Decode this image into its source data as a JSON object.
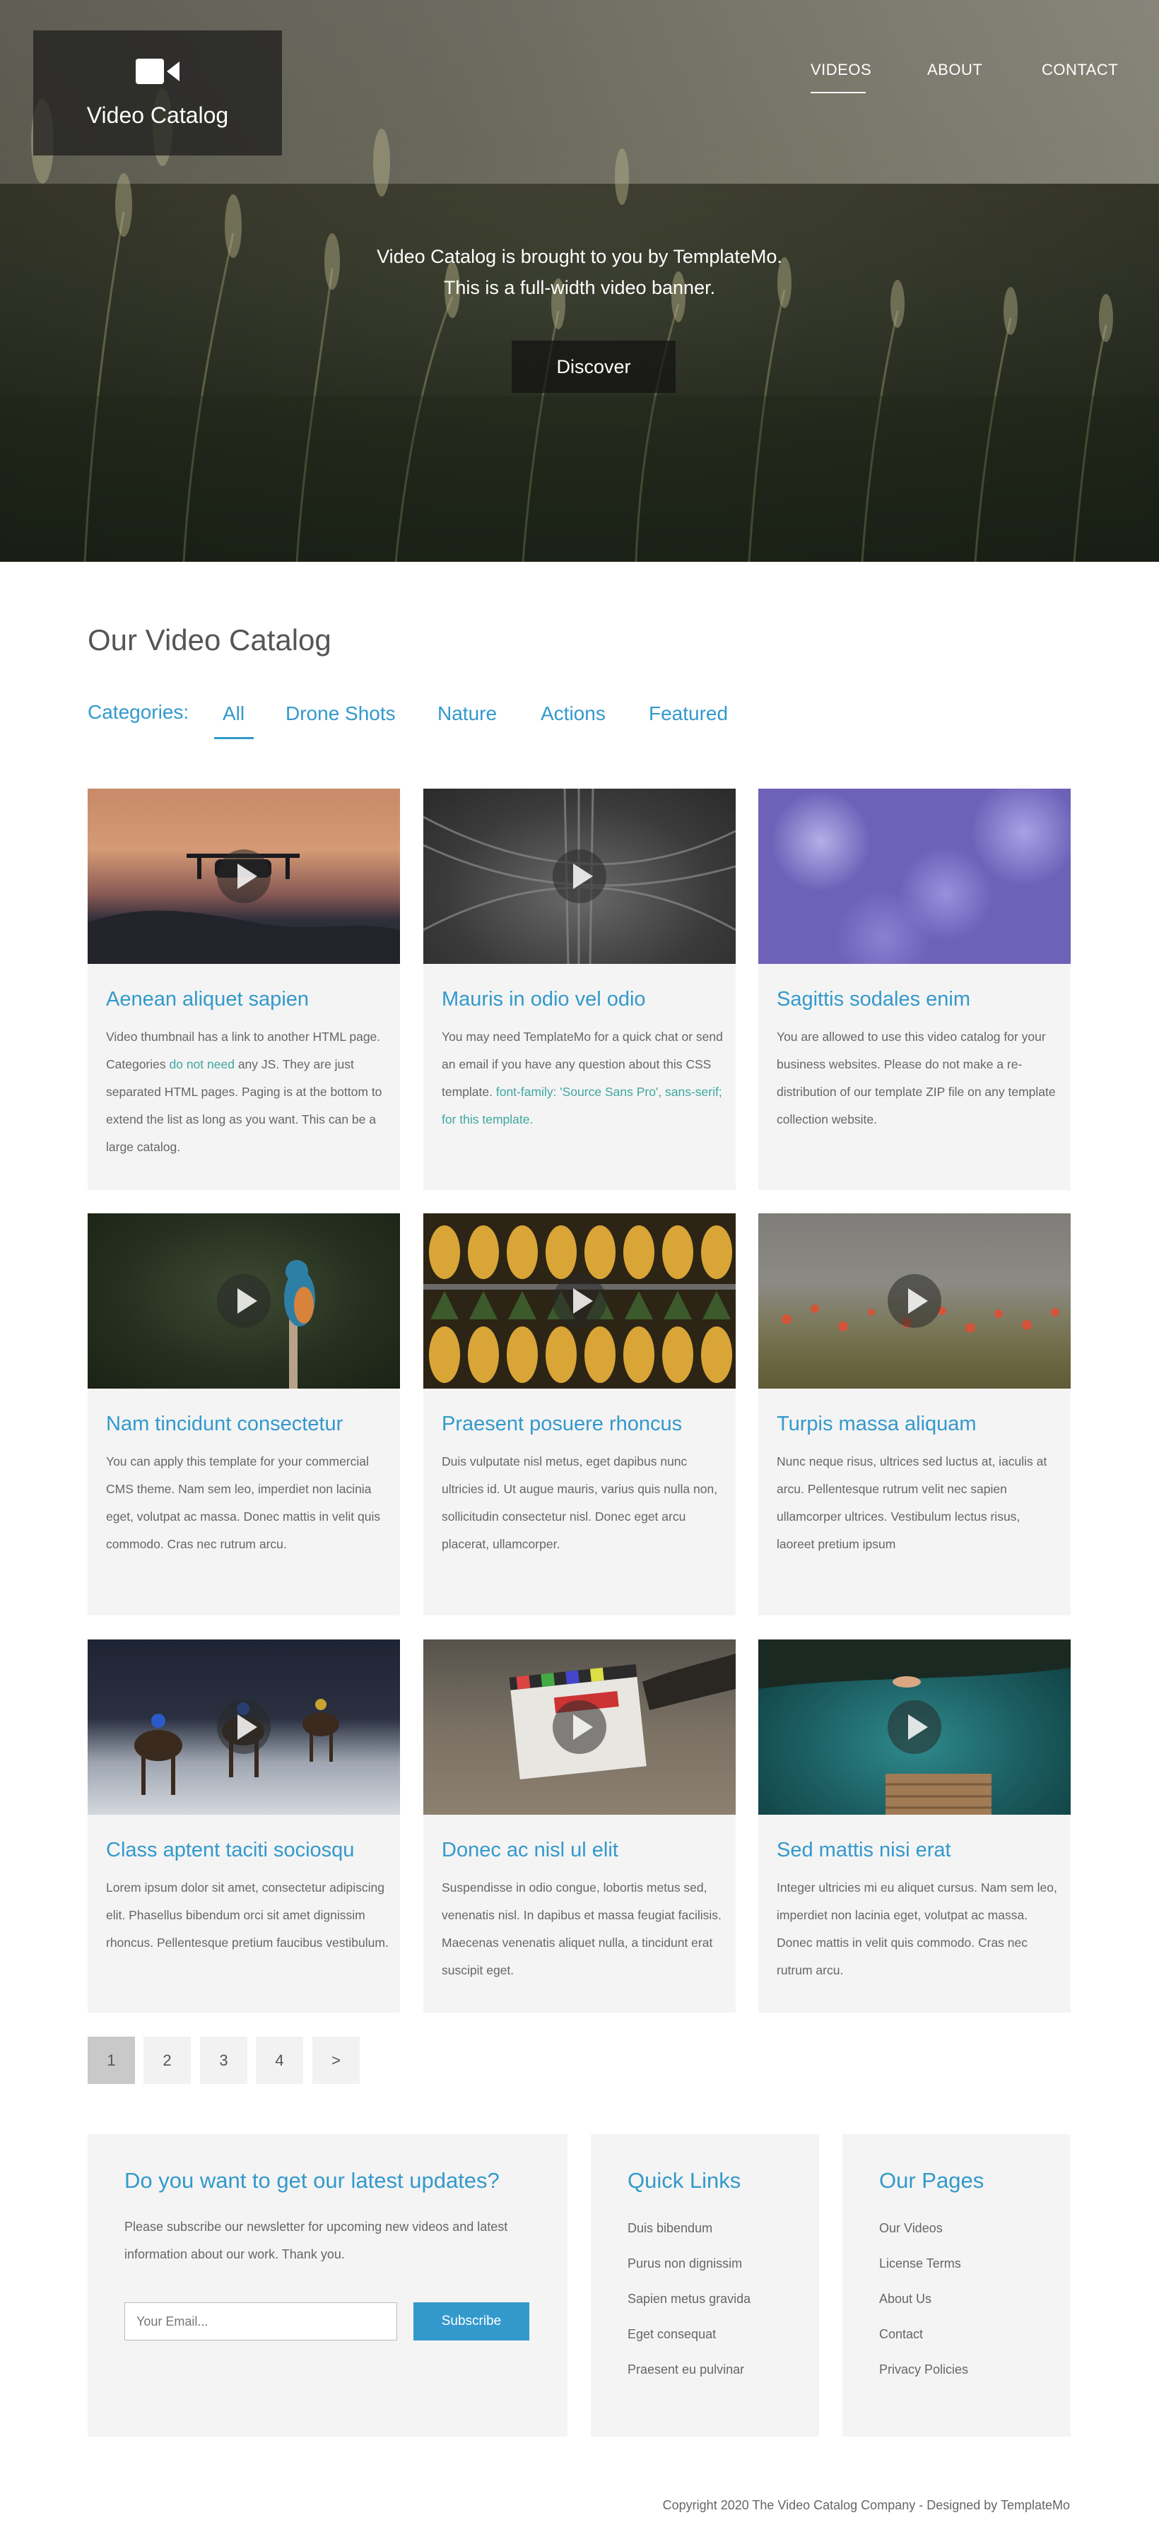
{
  "header": {
    "brand": "Video Catalog",
    "nav": {
      "videos": "VIDEOS",
      "about": "ABOUT",
      "contact": "CONTACT"
    },
    "tagline_1": "Video Catalog is brought to you by TemplateMo.",
    "tagline_2": "This is a full-width video banner.",
    "discover": "Discover"
  },
  "catalog": {
    "title": "Our Video Catalog",
    "categories_label": "Categories:",
    "categories": [
      "All",
      "Drone Shots",
      "Nature",
      "Actions",
      "Featured"
    ],
    "active_category": "All",
    "cards": [
      {
        "title": "Aenean aliquet sapien",
        "text_before": "Video thumbnail has a link to another HTML page. Categories ",
        "text_highlight": "do not need",
        "text_after": " any JS. They are just separated HTML pages. Paging is at the bottom to extend the list as long as you want. This can be a large catalog."
      },
      {
        "title": "Mauris in odio vel odio",
        "text_before": "You may need TemplateMo for a quick chat or send an email if you have any question about this CSS template. ",
        "text_highlight": "font-family: 'Source Sans Pro', sans-serif; for this template.",
        "text_after": ""
      },
      {
        "title": "Sagittis sodales enim",
        "text_before": "You are allowed to use this video catalog for your business websites. Please do not make a re-distribution of our template ZIP file on any template collection website.",
        "text_highlight": "",
        "text_after": ""
      },
      {
        "title": "Nam tincidunt consectetur",
        "text_before": "You can apply this template for your commercial CMS theme. Nam sem leo, imperdiet non lacinia eget, volutpat ac massa. Donec mattis in velit quis commodo. Cras nec rutrum arcu.",
        "text_highlight": "",
        "text_after": ""
      },
      {
        "title": "Praesent posuere rhoncus",
        "text_before": "Duis vulputate nisl metus, eget dapibus nunc ultricies id. Ut augue mauris, varius quis nulla non, sollicitudin consectetur nisl. Donec eget arcu placerat, ullamcorper.",
        "text_highlight": "",
        "text_after": ""
      },
      {
        "title": "Turpis massa aliquam",
        "text_before": "Nunc neque risus, ultrices sed luctus at, iaculis at arcu. Pellentesque rutrum velit nec sapien ullamcorper ultrices. Vestibulum lectus risus, laoreet pretium ipsum",
        "text_highlight": "",
        "text_after": ""
      },
      {
        "title": "Class aptent taciti sociosqu",
        "text_before": "Lorem ipsum dolor sit amet, consectetur adipiscing elit. Phasellus bibendum orci sit amet dignissim rhoncus. Pellentesque pretium faucibus vestibulum.",
        "text_highlight": "",
        "text_after": ""
      },
      {
        "title": "Donec ac nisl ul elit",
        "text_before": "Suspendisse in odio congue, lobortis metus sed, venenatis nisl. In dapibus et massa feugiat facilisis. Maecenas venenatis aliquet nulla, a tincidunt erat suscipit eget.",
        "text_highlight": "",
        "text_after": ""
      },
      {
        "title": "Sed mattis nisi erat",
        "text_before": "Integer ultricies mi eu aliquet cursus. Nam sem leo, imperdiet non lacinia eget, volutpat ac massa. Donec mattis in velit quis commodo. Cras nec rutrum arcu.",
        "text_highlight": "",
        "text_after": ""
      }
    ]
  },
  "pagination": {
    "pages": [
      "1",
      "2",
      "3",
      "4",
      ">"
    ],
    "current": "1"
  },
  "footer": {
    "newsletter": {
      "title": "Do you want to get our latest updates?",
      "text": "Please subscribe our newsletter for upcoming new videos and latest information about our work. Thank you.",
      "email_placeholder": "Your Email...",
      "subscribe": "Subscribe"
    },
    "quick_links": {
      "title": "Quick Links",
      "items": [
        "Duis bibendum",
        "Purus non dignissim",
        "Sapien metus gravida",
        "Eget consequat",
        "Praesent eu pulvinar"
      ]
    },
    "our_pages": {
      "title": "Our Pages",
      "items": [
        "Our Videos",
        "License Terms",
        "About Us",
        "Contact",
        "Privacy Policies"
      ]
    },
    "copyright": "Copyright 2020 The Video Catalog Company - Designed by TemplateMo"
  },
  "colors": {
    "accent": "#3399cc",
    "highlight": "#3ea7a0",
    "card_bg": "#f4f4f4"
  },
  "icons": {
    "logo": "video-camera-icon",
    "thumbnail_overlay": "play-icon"
  }
}
